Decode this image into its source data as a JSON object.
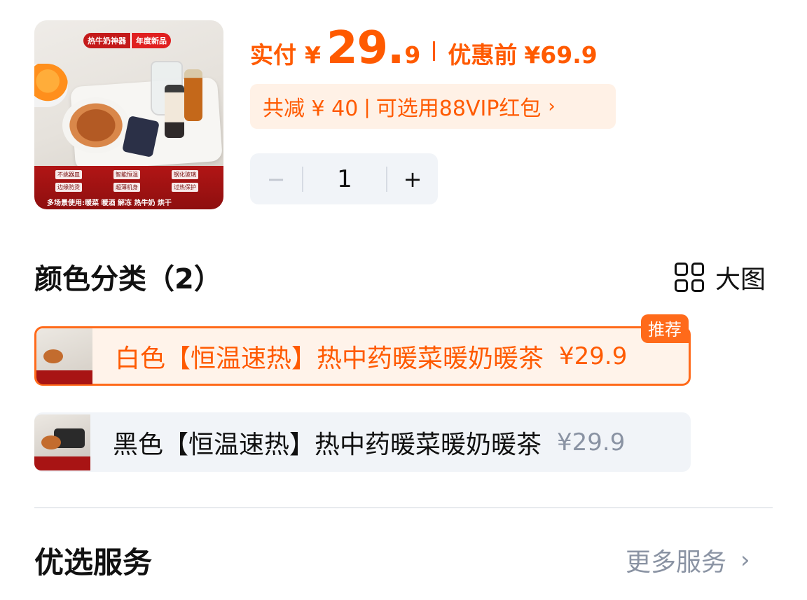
{
  "product": {
    "thumb_tag": "热牛奶神器",
    "thumb_tag_new": "年度新品",
    "thumb_features": [
      "不挑器皿",
      "智能恒温",
      "钢化玻璃",
      "边缘防烫",
      "超薄机身",
      "过热保护"
    ],
    "thumb_usage": "多场景使用:暖菜 暖酒 解冻 热牛奶 烘干"
  },
  "price": {
    "label": "实付",
    "currency": "¥",
    "integer": "29",
    "dot": ".",
    "decimal": "9",
    "original_label": "优惠前",
    "original_value": "¥69.9"
  },
  "discount": {
    "saved": "共减 ¥ 40",
    "separator": "|",
    "vip": "可选用88VIP红包",
    "chevron": "›"
  },
  "stepper": {
    "minus": "−",
    "quantity": "1",
    "plus": "+"
  },
  "color_section": {
    "title": "颜色分类（2）",
    "big_image_label": "大图",
    "options": [
      {
        "name": "白色【恒温速热】热中药暖菜暖奶暖茶",
        "price": "¥29.9",
        "badge": "推荐",
        "selected": true
      },
      {
        "name": "黑色【恒温速热】热中药暖菜暖奶暖茶",
        "price": "¥29.9",
        "selected": false
      }
    ]
  },
  "services": {
    "title": "优选服务",
    "more": "更多服务",
    "chevron": "›"
  },
  "colors": {
    "accent": "#ff5a00",
    "accent_bg": "#fff1e6",
    "neutral_bg": "#f1f4f8",
    "muted_text": "#8a93a3"
  }
}
